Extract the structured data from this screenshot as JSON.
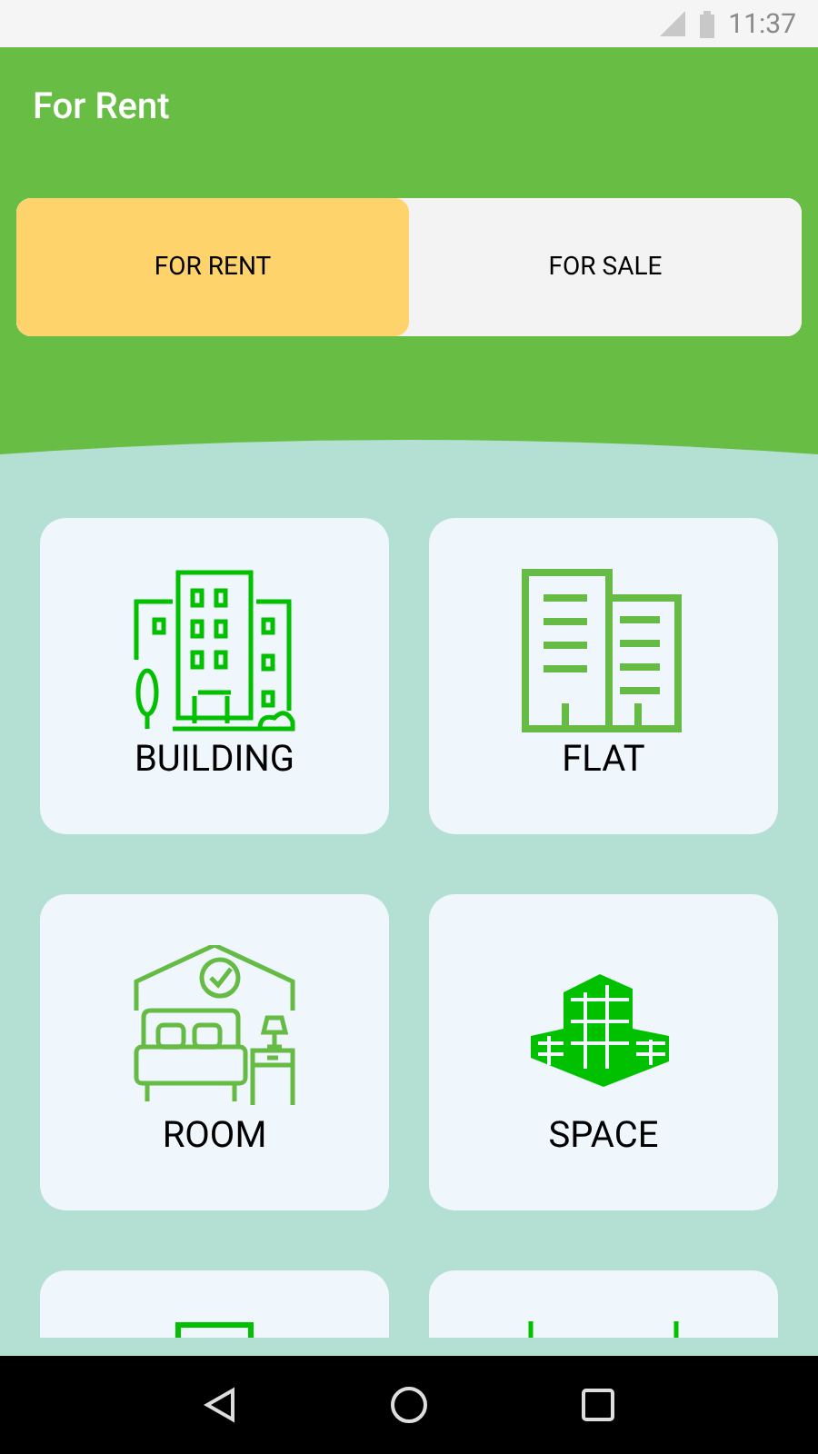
{
  "status_bar": {
    "time": "11:37"
  },
  "app_bar": {
    "title": "For Rent"
  },
  "tabs": [
    {
      "label": "FOR RENT",
      "selected": true
    },
    {
      "label": "FOR SALE",
      "selected": false
    }
  ],
  "categories": [
    {
      "kind": "tile",
      "label": "BUILDING"
    },
    {
      "kind": "tile",
      "label": "FLAT"
    },
    {
      "kind": "tile",
      "label": "ROOM"
    },
    {
      "kind": "tile",
      "label": "SPACE"
    },
    {
      "kind": "partial"
    },
    {
      "kind": "partial"
    }
  ]
}
